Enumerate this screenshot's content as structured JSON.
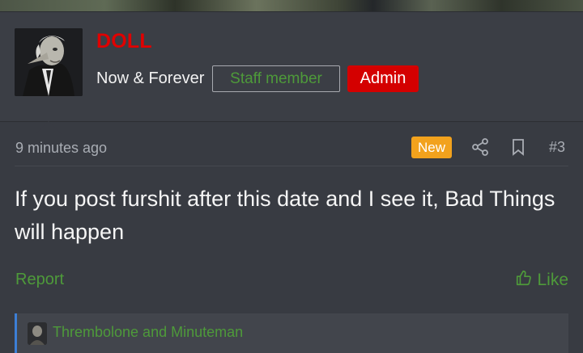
{
  "user": {
    "name": "DOLL",
    "title": "Now & Forever",
    "banners": [
      "Staff member",
      "Admin"
    ]
  },
  "post": {
    "time": "9 minutes ago",
    "badge": "New",
    "number": "#3",
    "body": "If you post furshit after this date and I see it, Bad Things will happen"
  },
  "actions": {
    "report": "Report",
    "like": "Like"
  },
  "reactions": {
    "names": "Thrembolone and Minuteman"
  },
  "colors": {
    "username": "#e00000",
    "link_green": "#4e9a3a",
    "admin_banner": "#d40000",
    "new_badge": "#f2a21d",
    "reaction_bar": "#3d7fd6"
  },
  "icons": [
    "share-icon",
    "bookmark-icon",
    "thumbs-up-icon"
  ]
}
